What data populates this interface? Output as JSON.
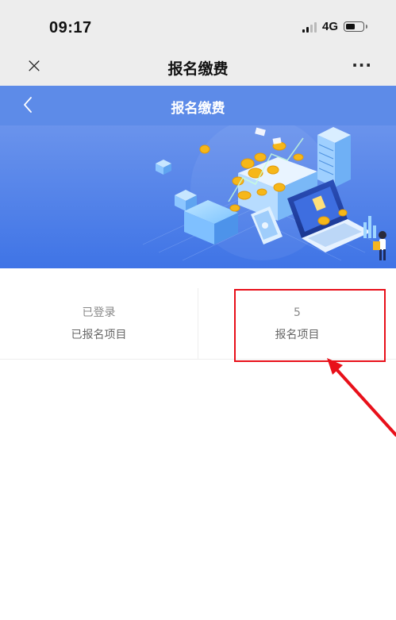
{
  "status_bar": {
    "time": "09:17",
    "network": "4G",
    "signal_icon": "signal-bars-icon",
    "battery_icon": "battery-icon"
  },
  "nav_bar": {
    "close_glyph": "×",
    "title": "报名缴费",
    "more_glyph": "···"
  },
  "page_header": {
    "title": "报名缴费",
    "back_icon": "chevron-left-icon",
    "color": "#5d8be8"
  },
  "stats": [
    {
      "value": "已登录",
      "label": "已报名项目"
    },
    {
      "value": "5",
      "label": "报名项目"
    }
  ],
  "annotation": {
    "color": "#e8101a"
  }
}
